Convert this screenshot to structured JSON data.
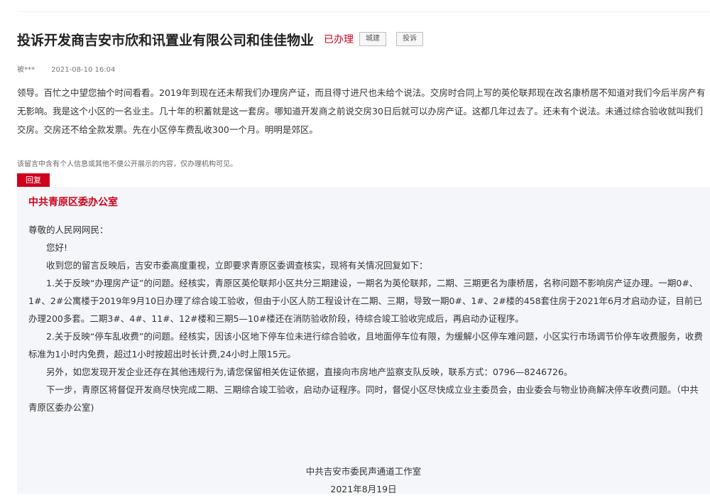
{
  "title": "投诉开发商吉安市欣和讯置业有限公司和佳佳物业",
  "status": "已办理",
  "tags": [
    "城建",
    "投诉"
  ],
  "author": "被***",
  "date": "2021-08-10 16:04",
  "message": "领导。百忙之中望您抽个时间看看。2019年到现在还未帮我们办理房产证，而且得寸进尺也未给个说法。交房时合同上写的英伦联邦现在改名康桥居不知道对我们今后半房产有无影响。我是这个小区的一名业主。几十年的积蓄就是这一套房。哪知道开发商之前说交房30日后就可以办房产证。这都几年过去了。还未有个说法。未通过综合验收就叫我们交房。交房还不给全款发票。先在小区停车费乱收300一个月。明明是郊区。",
  "privacy_notice": "该留言中含有个人信息或其他不便公开展示的内容，仅办理机构可见。",
  "reply_badge": "回复",
  "reply": {
    "org": "中共青原区委办公室",
    "salutation": "尊敬的人民网网民：",
    "paragraphs": [
      "您好!",
      "收到您的留言反映后，吉安市委高度重视，立即要求青原区委调查核实，现将有关情况回复如下：",
      "1.关于反映“办理房产证”的问题。经核实，青原区英伦联邦小区共分三期建设，一期名为英伦联邦，二期、三期更名为康桥居，名称问题不影响房产证办理。一期0#、1#、2#公寓楼于2019年9月10日办理了综合竣工验收，但由于小区人防工程设计在二期、三期，导致一期0#、1#、2#楼的458套住房于2021年6月才启动办证，目前已办理200多套。二期3#、4#、11#、12#楼和三期5—10#楼还在消防验收阶段，待综合竣工验收完成后，再启动办证程序。",
      "2.关于反映“停车乱收费”的问题。经核实，因该小区地下停车位未进行综合验收，且地面停车位有限，为缓解小区停车难问题，小区实行市场调节价停车收费服务，收费标准为1小时内免费，超过1小时按超出时长计费,24小时上限15元。",
      "另外，如您发现开发企业还存在其他违规行为,请您保留相关佐证依据，直接向市房地产监察支队反映，联系方式：0796—8246726。",
      "下一步，青原区将督促开发商尽快完成二期、三期综合竣工验收，启动办证程序。同时，督促小区尽快成立业主委员会，由业委会与物业协商解决停车收费问题。（中共青原区委办公室)"
    ],
    "signature_org": "中共吉安市委民声通道工作室",
    "signature_date": "2021年8月19日"
  }
}
